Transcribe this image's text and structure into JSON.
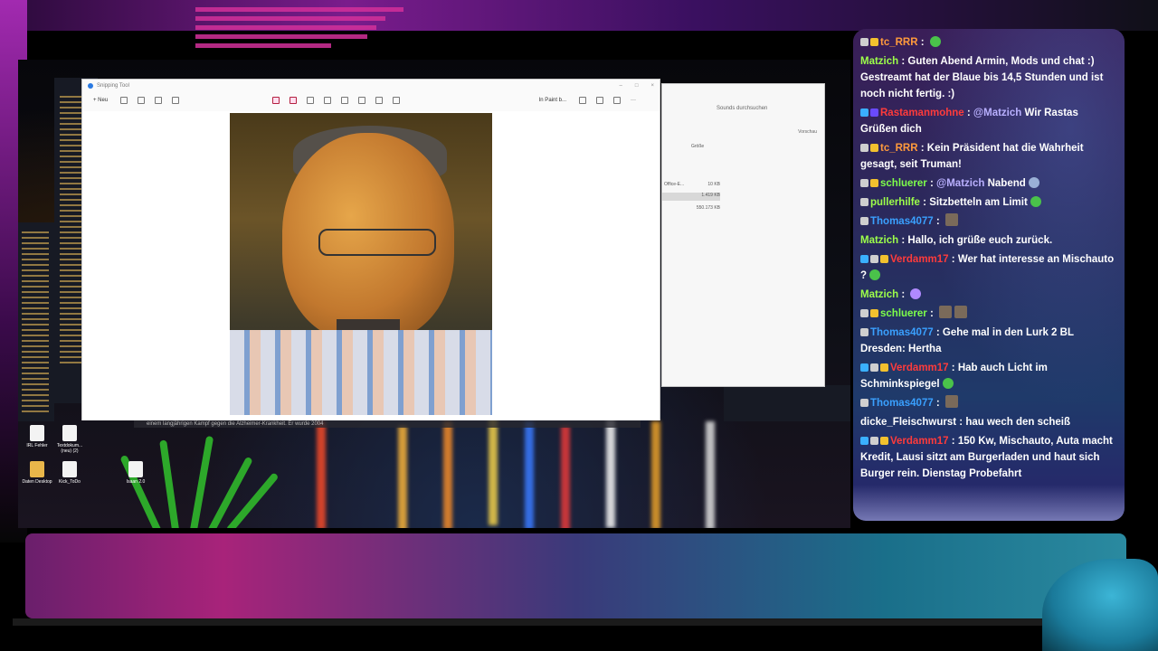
{
  "snipping_tool": {
    "title": "Snipping Tool",
    "new_label": "Neu",
    "paint_label": "In Paint b...",
    "window_controls": [
      "–",
      "□",
      "×"
    ]
  },
  "caption_text": "einem langjährigen Kampf gegen die Alzheimer-Krankheit. Er wurde 2004",
  "explorer": {
    "search_label": "Sounds durchsuchen",
    "preview_label": "Vorschau",
    "size_header": "Größe",
    "rows": [
      {
        "name": "Office-E...",
        "size": "10 KB"
      },
      {
        "name": "",
        "size": "1.419 KB"
      },
      {
        "name": "",
        "size": "550.173 KB"
      }
    ]
  },
  "desktop_icons": [
    {
      "label": "IRL Fehler",
      "type": "file"
    },
    {
      "label": "Textdokum... (neu) (2)",
      "type": "file"
    },
    {
      "label": "Daten Desktop",
      "type": "folder"
    },
    {
      "label": "Kick_ToDo",
      "type": "file"
    },
    {
      "label": "Isaan 2.0",
      "type": "file"
    }
  ],
  "chat": {
    "messages": [
      {
        "user": "tc_RRR",
        "color": "#ff9a3c",
        "badges": [
          "#cfcfcf",
          "#f2c12e"
        ],
        "text": "",
        "emote": "#4ac24a"
      },
      {
        "user": "Matzich",
        "color": "#9dff4a",
        "badges": [],
        "text": "Guten Abend Armin, Mods und chat :) Gestreamt hat der Blaue bis 14,5 Stunden und ist noch nicht fertig. :)"
      },
      {
        "user": "Rastamanmohne",
        "color": "#ff3b3b",
        "badges": [
          "#3ab0ff",
          "#6a4aff"
        ],
        "mention": "@Matzich",
        "text": "Wir Rastas Grüßen dich"
      },
      {
        "user": "tc_RRR",
        "color": "#ff9a3c",
        "badges": [
          "#cfcfcf",
          "#f2c12e"
        ],
        "text": "Kein Präsident hat die Wahrheit gesagt, seit Truman!"
      },
      {
        "user": "schluerer",
        "color": "#7dff4a",
        "badges": [
          "#cfcfcf",
          "#f2c12e"
        ],
        "mention": "@Matzich",
        "text": "Nabend",
        "emote": "#9ab0d6"
      },
      {
        "user": "pullerhilfe",
        "color": "#9dff4a",
        "badges": [
          "#cfcfcf"
        ],
        "text": "Sitzbetteln am Limit",
        "emote": "#4ac24a"
      },
      {
        "user": "Thomas4077",
        "color": "#3aa0ff",
        "badges": [
          "#cfcfcf"
        ],
        "text": "",
        "emote_sq": [
          "#7a6a5a"
        ]
      },
      {
        "user": "Matzich",
        "color": "#9dff4a",
        "badges": [],
        "text": "Hallo, ich grüße euch zurück."
      },
      {
        "user": "Verdamm17",
        "color": "#ff3b3b",
        "badges": [
          "#3ab0ff",
          "#cfcfcf",
          "#f2c12e"
        ],
        "text": "Wer hat interesse an Mischauto ?",
        "emote": "#4ac24a"
      },
      {
        "user": "Matzich",
        "color": "#9dff4a",
        "badges": [],
        "text": "",
        "emote": "#b08aff"
      },
      {
        "user": "schluerer",
        "color": "#7dff4a",
        "badges": [
          "#cfcfcf",
          "#f2c12e"
        ],
        "text": "",
        "emote_sq": [
          "#7a6a5a",
          "#7a6a5a"
        ]
      },
      {
        "user": "Thomas4077",
        "color": "#3aa0ff",
        "badges": [
          "#cfcfcf"
        ],
        "text": "Gehe mal in den Lurk 2 BL Dresden: Hertha"
      },
      {
        "user": "Verdamm17",
        "color": "#ff3b3b",
        "badges": [
          "#3ab0ff",
          "#cfcfcf",
          "#f2c12e"
        ],
        "text": "Hab auch Licht im Schminkspiegel",
        "emote": "#4ac24a"
      },
      {
        "user": "Thomas4077",
        "color": "#3aa0ff",
        "badges": [
          "#cfcfcf"
        ],
        "text": "",
        "emote_sq": [
          "#7a6a5a"
        ]
      },
      {
        "user": "dicke_Fleischwurst",
        "color": "#ffffff",
        "badges": [],
        "text": "hau wech den scheiß"
      },
      {
        "user": "Verdamm17",
        "color": "#ff3b3b",
        "badges": [
          "#3ab0ff",
          "#cfcfcf",
          "#f2c12e"
        ],
        "text": "150 Kw, Mischauto, Auta macht Kredit, Lausi sitzt am Burgerladen und haut sich Burger rein. Dienstag Probefahrt"
      }
    ]
  },
  "colors": {
    "accent_magenta": "#d2309a",
    "chat_bg": "#2a2a5c"
  }
}
